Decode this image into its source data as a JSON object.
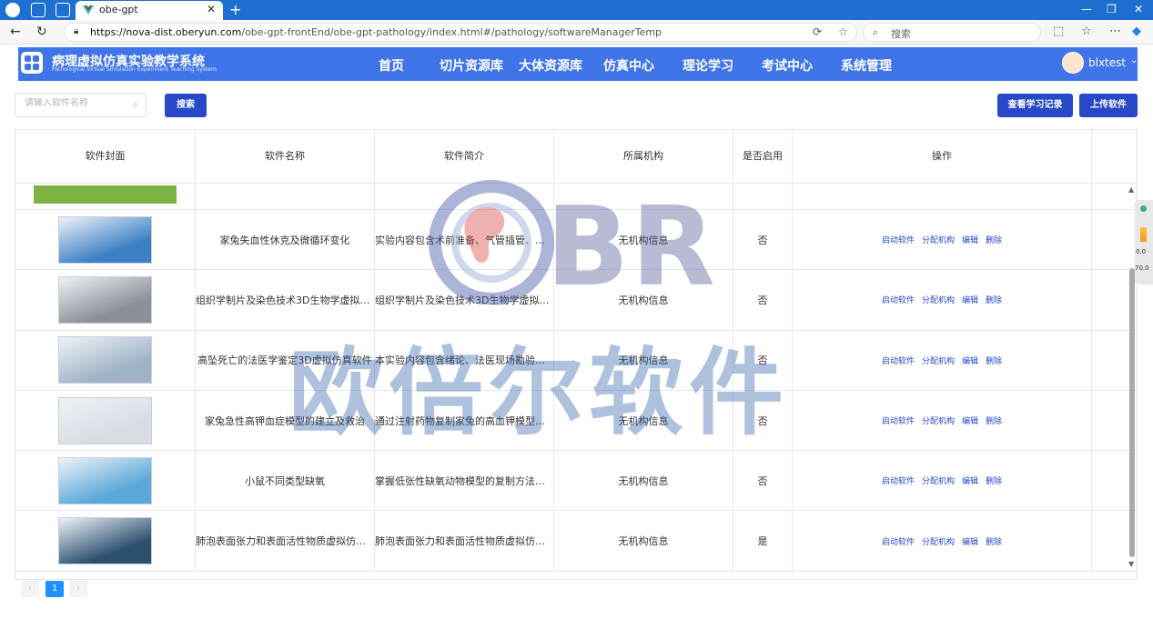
{
  "browser": {
    "tab_title": "obe-gpt",
    "url_host": "https://nova-dist.oberyun.com",
    "url_path": "/obe-gpt-frontEnd/obe-gpt-pathology/index.html#/pathology/softwareManagerTemp",
    "search_placeholder": "搜索"
  },
  "app": {
    "title": "病理虚拟仿真实验教学系统",
    "subtitle": "Pathological Virtual Simulation Experiment Teaching System",
    "menu": [
      "首页",
      "切片资源库",
      "大体资源库",
      "仿真中心",
      "理论学习",
      "考试中心",
      "系统管理"
    ],
    "username": "blxtest"
  },
  "toolbar": {
    "search_placeholder": "请输入软件名称",
    "search_button": "搜索",
    "history_button": "查看学习记录",
    "upload_button": "上传软件"
  },
  "table": {
    "headers": [
      "软件封面",
      "软件名称",
      "软件简介",
      "所属机构",
      "是否启用",
      "操作"
    ],
    "actions": [
      "启动软件",
      "分配机构",
      "编辑",
      "删除"
    ],
    "rows": [
      {
        "name": "家兔失血性休克及微循环变化",
        "intro": "实验内容包含术前准备、气管插管、放...",
        "org": "无机构信息",
        "enabled": "否",
        "thumb_color": "#3b7fc4"
      },
      {
        "name": "组织学制片及染色技术3D生物学虚拟仿...",
        "intro": "组织学制片及染色技术3D生物学虚拟仿...",
        "org": "无机构信息",
        "enabled": "否",
        "thumb_color": "#8a8f98"
      },
      {
        "name": "高坠死亡的法医学鉴定3D虚拟仿真软件",
        "intro": "本实验内容包含绪论、法医现场勘验、...",
        "org": "无机构信息",
        "enabled": "否",
        "thumb_color": "#9fb3c7"
      },
      {
        "name": "家兔急性高钾血症模型的建立及救治",
        "intro": "通过注射药物复制家兔的高血钾模型，...",
        "org": "无机构信息",
        "enabled": "否",
        "thumb_color": "#d8dde3"
      },
      {
        "name": "小鼠不同类型缺氧",
        "intro": "掌握低张性缺氧动物模型的复制方法，...",
        "org": "无机构信息",
        "enabled": "否",
        "thumb_color": "#5aa7d9"
      },
      {
        "name": "肺泡表面张力和表面活性物质虚拟仿真...",
        "intro": "肺泡表面张力和表面活性物质虚拟仿真...",
        "org": "无机构信息",
        "enabled": "是",
        "thumb_color": "#2c4f6e"
      }
    ]
  },
  "pager": {
    "current": "1"
  },
  "watermark": {
    "logo": "BR",
    "text": "欧倍尔软件"
  },
  "side_widget": {
    "val1": "0.0",
    "val2": "70.0"
  }
}
